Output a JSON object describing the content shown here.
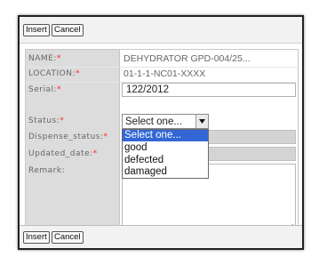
{
  "toolbar_top": {
    "insert_label": "Insert",
    "cancel_label": "Cancel"
  },
  "toolbar_bottom": {
    "insert_label": "Insert",
    "cancel_label": "Cancel"
  },
  "form": {
    "required_marker": "*",
    "name": {
      "label": "NAME:",
      "value": "DEHYDRATOR GPD-004/25..."
    },
    "location": {
      "label": "LOCATION:",
      "value": "01-1-1-NC01-XXXX"
    },
    "serial": {
      "label": "Serial:",
      "value": "122/2012"
    },
    "status": {
      "label": "Status:",
      "selected": "Select one...",
      "options": [
        "Select one...",
        "good",
        "defected",
        "damaged"
      ]
    },
    "dispense_status": {
      "label": "Dispense_status:",
      "value": ""
    },
    "updated_date": {
      "label": "Updated_date:",
      "value": ""
    },
    "remark": {
      "label": "Remark:",
      "value": ""
    }
  },
  "colors": {
    "required": "#ff2a2a",
    "label_bg": "#dcdcdc",
    "option_highlight": "#3367d6"
  }
}
